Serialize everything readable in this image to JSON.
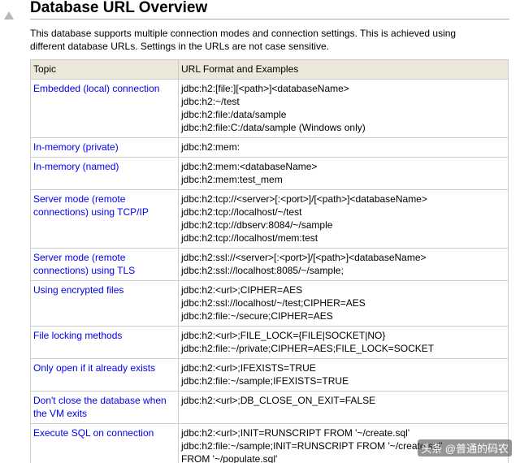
{
  "heading": "Database URL Overview",
  "intro": "This database supports multiple connection modes and connection settings. This is achieved using different database URLs. Settings in the URLs are not case sensitive.",
  "table": {
    "headers": [
      "Topic",
      "URL Format and Examples"
    ],
    "rows": [
      {
        "topic": "Embedded (local) connection",
        "urls": [
          "jdbc:h2:[file:][<path>]<databaseName>",
          "jdbc:h2:~/test",
          "jdbc:h2:file:/data/sample",
          "jdbc:h2:file:C:/data/sample (Windows only)"
        ]
      },
      {
        "topic": "In-memory (private)",
        "urls": [
          "jdbc:h2:mem:"
        ]
      },
      {
        "topic": "In-memory (named)",
        "urls": [
          "jdbc:h2:mem:<databaseName>",
          "jdbc:h2:mem:test_mem"
        ]
      },
      {
        "topic": "Server mode (remote connections) using TCP/IP",
        "urls": [
          "jdbc:h2:tcp://<server>[:<port>]/[<path>]<databaseName>",
          "jdbc:h2:tcp://localhost/~/test",
          "jdbc:h2:tcp://dbserv:8084/~/sample",
          "jdbc:h2:tcp://localhost/mem:test"
        ]
      },
      {
        "topic": "Server mode (remote connections) using TLS",
        "urls": [
          "jdbc:h2:ssl://<server>[:<port>]/[<path>]<databaseName>",
          "jdbc:h2:ssl://localhost:8085/~/sample;"
        ]
      },
      {
        "topic": "Using encrypted files",
        "urls": [
          "jdbc:h2:<url>;CIPHER=AES",
          "jdbc:h2:ssl://localhost/~/test;CIPHER=AES",
          "jdbc:h2:file:~/secure;CIPHER=AES"
        ]
      },
      {
        "topic": "File locking methods",
        "urls": [
          "jdbc:h2:<url>;FILE_LOCK={FILE|SOCKET|NO}",
          "jdbc:h2:file:~/private;CIPHER=AES;FILE_LOCK=SOCKET"
        ]
      },
      {
        "topic": "Only open if it already exists",
        "urls": [
          "jdbc:h2:<url>;IFEXISTS=TRUE",
          "jdbc:h2:file:~/sample;IFEXISTS=TRUE"
        ]
      },
      {
        "topic": "Don't close the database when the VM exits",
        "urls": [
          "jdbc:h2:<url>;DB_CLOSE_ON_EXIT=FALSE"
        ]
      },
      {
        "topic": "Execute SQL on connection",
        "urls": [
          "jdbc:h2:<url>;INIT=RUNSCRIPT FROM '~/create.sql'",
          "jdbc:h2:file:~/sample;INIT=RUNSCRIPT FROM '~/create.sql'",
          "FROM '~/populate.sql'"
        ]
      }
    ]
  },
  "watermark": "头条 @普通的码农"
}
